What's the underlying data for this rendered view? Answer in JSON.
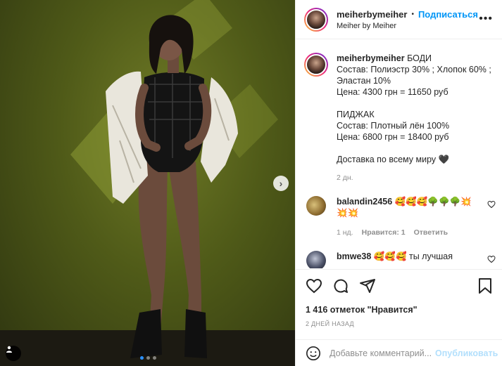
{
  "header": {
    "username": "meiherbymeiher",
    "separator": "•",
    "follow_label": "Подписаться",
    "subtitle": "Meiher by Meiher",
    "more_icon": "more-horizontal-icon"
  },
  "caption": {
    "username": "meiherbymeiher",
    "lines": [
      "БОДИ",
      "Состав: Полиэстр 30% ; Хлопок 60% ;",
      "Эластан 10%",
      "Цена: 4300 грн = 11650 руб",
      "ПИДЖАК",
      "Состав: Плотный лён 100%",
      "Цена: 6800 грн = 18400 руб",
      "Доставка по всему миру 🖤"
    ],
    "time": "2 дн."
  },
  "comments": [
    {
      "username": "balandin2456",
      "text_line1": "🥰🥰🥰🌳🌳🌳💥",
      "text_line2": "💥💥",
      "time": "1 нд.",
      "likes": "Нравится: 1",
      "reply": "Ответить"
    },
    {
      "username": "bmwe38",
      "text": "🥰🥰🥰 ты лучшая"
    }
  ],
  "actions": {
    "likes_text": "1 416 отметок \"Нравится\"",
    "date": "2 ДНЕЙ НАЗАД"
  },
  "add_comment": {
    "placeholder": "Добавьте комментарий...",
    "publish_label": "Опубликовать"
  },
  "carousel": {
    "total_slides": 3,
    "active_slide": 1
  },
  "colors": {
    "accent": "#0095f6",
    "publish_disabled": "#b2dffc",
    "muted": "#8e8e8e",
    "wall_green": "#5a6520"
  }
}
